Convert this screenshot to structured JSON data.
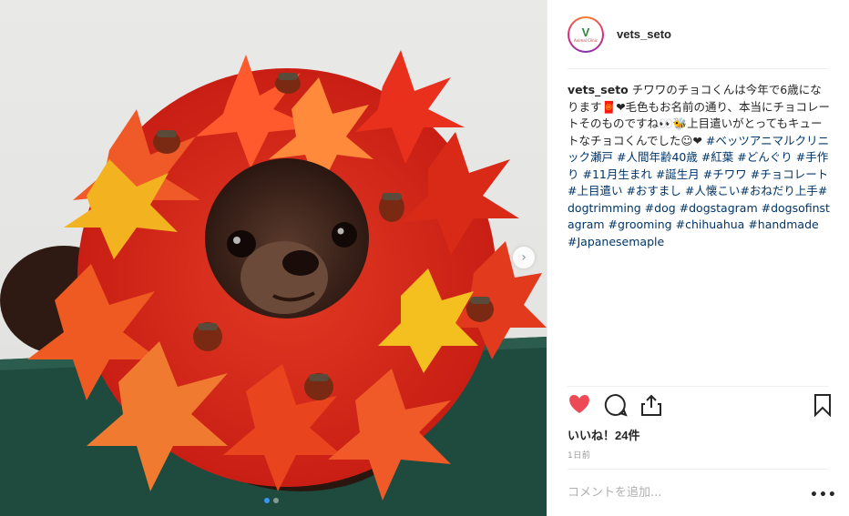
{
  "post": {
    "username": "vets_seto",
    "avatar_logo": "V",
    "avatar_sub": "Animal Clinic",
    "caption_user": "vets_seto",
    "caption_text": "チワワのチョコくんは今年で6歳になります🧧❤毛色もお名前の通り、本当にチョコレートそのものですね👀🐝上目遣いがとってもキュートなチョコくんでした☺❤",
    "caption_tags": "#ベッツアニマルクリニック瀬戸 #人間年齢40歳 #紅葉 #どんぐり #手作り #11月生まれ #誕生月 #チワワ #チョコレート #上目遣い #おすまし #人懐こい#おねだり上手#dogtrimming #dog #dogstagram #dogsofinstagram #grooming #chihuahua #handmade #Japanesemaple",
    "likes": "いいね！24件",
    "time": "1日前",
    "comment_placeholder": "コメントを追加...",
    "more_label": "•••",
    "next_label": "›"
  },
  "colors": {
    "like_red": "#ed4956",
    "tag_blue": "#003569",
    "active_dot": "#3897f0"
  },
  "icons": [
    "heart-icon",
    "comment-icon",
    "share-icon",
    "bookmark-icon",
    "chevron-right-icon"
  ]
}
